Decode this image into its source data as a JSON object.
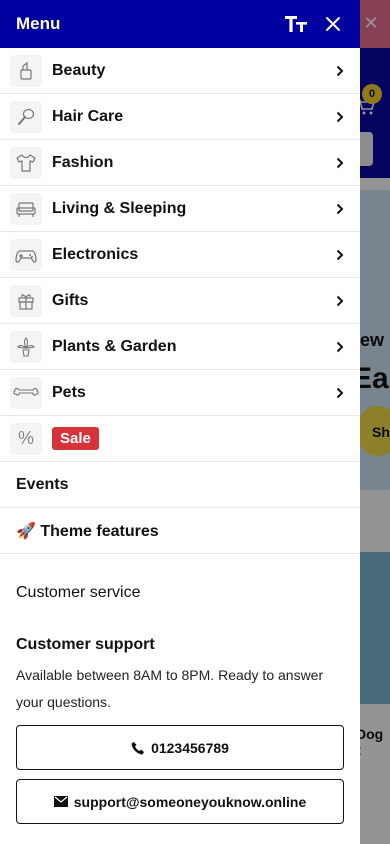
{
  "drawer": {
    "title": "Menu",
    "font_size_glyph": "TT",
    "close_glyph": "✕"
  },
  "menu": {
    "items": [
      {
        "label": "Beauty",
        "icon": "lipstick-icon"
      },
      {
        "label": "Hair Care",
        "icon": "hairbrush-icon"
      },
      {
        "label": "Fashion",
        "icon": "tshirt-icon"
      },
      {
        "label": "Living & Sleeping",
        "icon": "sofa-icon"
      },
      {
        "label": "Electronics",
        "icon": "gamepad-icon"
      },
      {
        "label": "Gifts",
        "icon": "gift-icon"
      },
      {
        "label": "Plants & Garden",
        "icon": "plant-icon"
      },
      {
        "label": "Pets",
        "icon": "bone-icon"
      }
    ],
    "sale": {
      "label": "Sale",
      "icon": "percent-icon",
      "icon_glyph": "%",
      "color": "#d6323a"
    },
    "events": "Events",
    "theme_features": "🚀 Theme features"
  },
  "support": {
    "customer_service": "Customer service",
    "title": "Customer support",
    "text": "Available between 8AM to 8PM. Ready to answer your questions.",
    "phone": "0123456789",
    "email": "support@someoneyouknow.online"
  },
  "background": {
    "cart_count": "0",
    "hero_line1": "ew",
    "hero_line2": "Ear",
    "hero_button": "Sh",
    "card_caption": "Dog t"
  },
  "colors": {
    "header": "#0000a0",
    "sale": "#d6323a",
    "badge": "#f7d22e"
  }
}
